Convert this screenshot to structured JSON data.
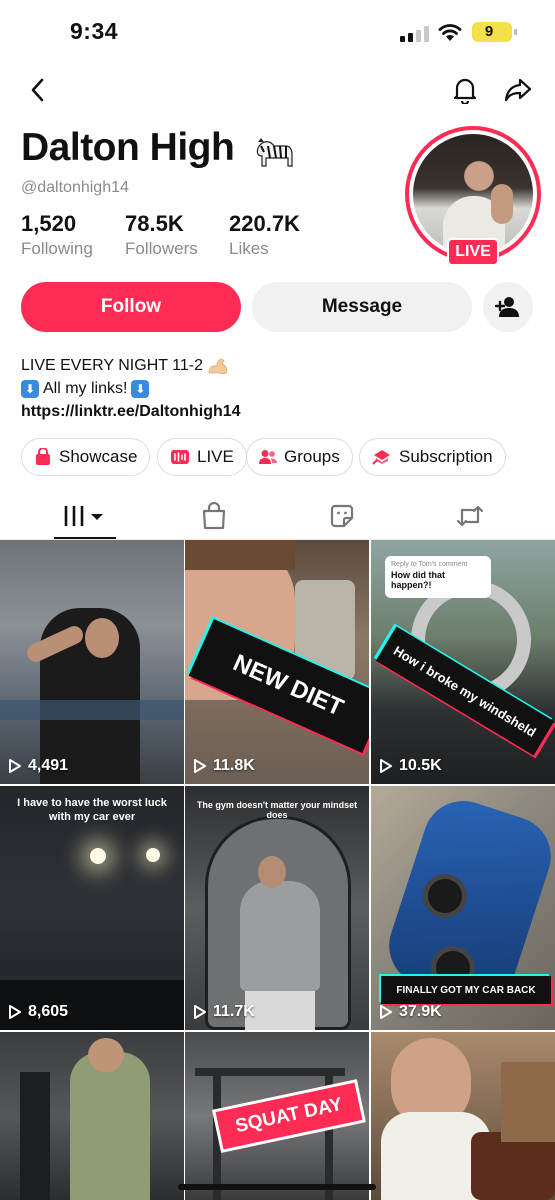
{
  "status_bar": {
    "time": "9:34",
    "battery": "9"
  },
  "profile": {
    "name": "Dalton High",
    "handle": "@daltonhigh14",
    "stats": [
      {
        "value": "1,520",
        "label": "Following"
      },
      {
        "value": "78.5K",
        "label": "Followers"
      },
      {
        "value": "220.7K",
        "label": "Likes"
      }
    ],
    "live_badge": "LIVE"
  },
  "actions": {
    "follow": "Follow",
    "message": "Message"
  },
  "bio": {
    "line1": "LIVE EVERY NIGHT 11-2",
    "line2": "All my links!",
    "link": "https://linktr.ee/Daltonhigh14"
  },
  "pills": [
    {
      "label": "Showcase",
      "icon": "bag-icon",
      "color": "#fe2c55"
    },
    {
      "label": "LIVE",
      "icon": "live-icon",
      "color": "#fe2c55"
    },
    {
      "label": "Groups",
      "icon": "group-icon",
      "color": "#fe2c55"
    },
    {
      "label": "Subscription",
      "icon": "subscription-icon",
      "color": "#fe2c55"
    }
  ],
  "tabs": [
    {
      "icon": "videos-grid-icon",
      "active": true
    },
    {
      "icon": "shop-bag-icon",
      "active": false
    },
    {
      "icon": "sticker-icon",
      "active": false
    },
    {
      "icon": "repost-icon",
      "active": false
    }
  ],
  "videos": [
    {
      "views": "4,491",
      "overlay": ""
    },
    {
      "views": "11.8K",
      "overlay": "NEW DIET"
    },
    {
      "views": "10.5K",
      "overlay": "How i broke my windsheld",
      "reply_label": "Reply to Tom's comment",
      "reply_text": "How did that happen?!"
    },
    {
      "views": "8,605",
      "overlay": "I have to have the worst luck with my car ever"
    },
    {
      "views": "11.7K",
      "overlay": "The gym doesn't matter your mindset does"
    },
    {
      "views": "37.9K",
      "overlay": "FINALLY GOT MY CAR BACK"
    },
    {
      "views": "",
      "overlay": ""
    },
    {
      "views": "",
      "overlay": "SQUAT DAY"
    },
    {
      "views": "",
      "overlay": ""
    }
  ],
  "colors": {
    "accent": "#fe2c55",
    "teal": "#25f4ee"
  }
}
